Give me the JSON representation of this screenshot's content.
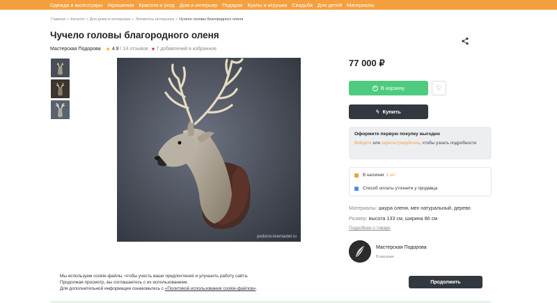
{
  "nav": {
    "items": [
      "Одежда и аксессуары",
      "Украшения",
      "Красота и уход",
      "Дом и интерьер",
      "Подарки",
      "Куклы и игрушки",
      "Свадьба",
      "Для детей",
      "Материалы"
    ]
  },
  "breadcrumbs": [
    "Главная",
    "Каталог",
    "Для дома и интерьера",
    "Элементы интерьера",
    "Чучело головы благородного оленя"
  ],
  "breadcrumb_separator": "»",
  "product": {
    "title": "Чучело головы благородного оленя",
    "shop": "Мастерская Подорова",
    "rating": "4.9",
    "reviews": "/ 14 отзывов",
    "favorites": "7 добавлений в избранное",
    "image_watermark": "podorov.livemaster.ru"
  },
  "icons": {
    "share": "share-icon",
    "star": "star-icon",
    "heart": "heart-icon",
    "cart": "cart-plus-icon",
    "buy": "lightning-icon",
    "lock": "lock-icon",
    "card": "card-icon"
  },
  "purchase": {
    "price": "77 000 ₽",
    "cart_label": "В корзину",
    "buy_label": "Купить",
    "promo_title": "Оформите первую покупку выгодно",
    "promo_login": "Войдите",
    "promo_or": " или ",
    "promo_register": "зарегистрируйтесь",
    "promo_rest": ", чтобы узнать подробности",
    "stock_label": "В наличии",
    "stock_value": "1 шт",
    "payment_label": "Способ оплаты уточните у продавца"
  },
  "specs": {
    "materials_key": "Материалы:",
    "materials_value": " шкура оленя, мех натуральный, дерево",
    "size_key": "Размер:",
    "size_value": " высота 133 см, ширина 86 см",
    "more_link": "Подробнее о товаре"
  },
  "seller": {
    "name": "Мастерская Подорова",
    "link": "В магазин"
  },
  "cookie": {
    "line1": "Мы используем cookie-файлы, чтобы учесть ваши предпочтения и улучшить работу сайта.",
    "line2": "Продолжая просмотр, вы соглашаетесь с их использованием.",
    "line3": "Для дополнительной информации ознакомьтесь с ",
    "link": "«Политикой использования cookie-файлов»",
    "line3_end": ".",
    "accept": "Продолжить"
  },
  "colors": {
    "nav_bg": "#f5a03f",
    "cart_green": "#4ecb7e",
    "dark_button": "#333840",
    "heart_red": "#e0334d",
    "link_orange": "#f5a03f"
  }
}
